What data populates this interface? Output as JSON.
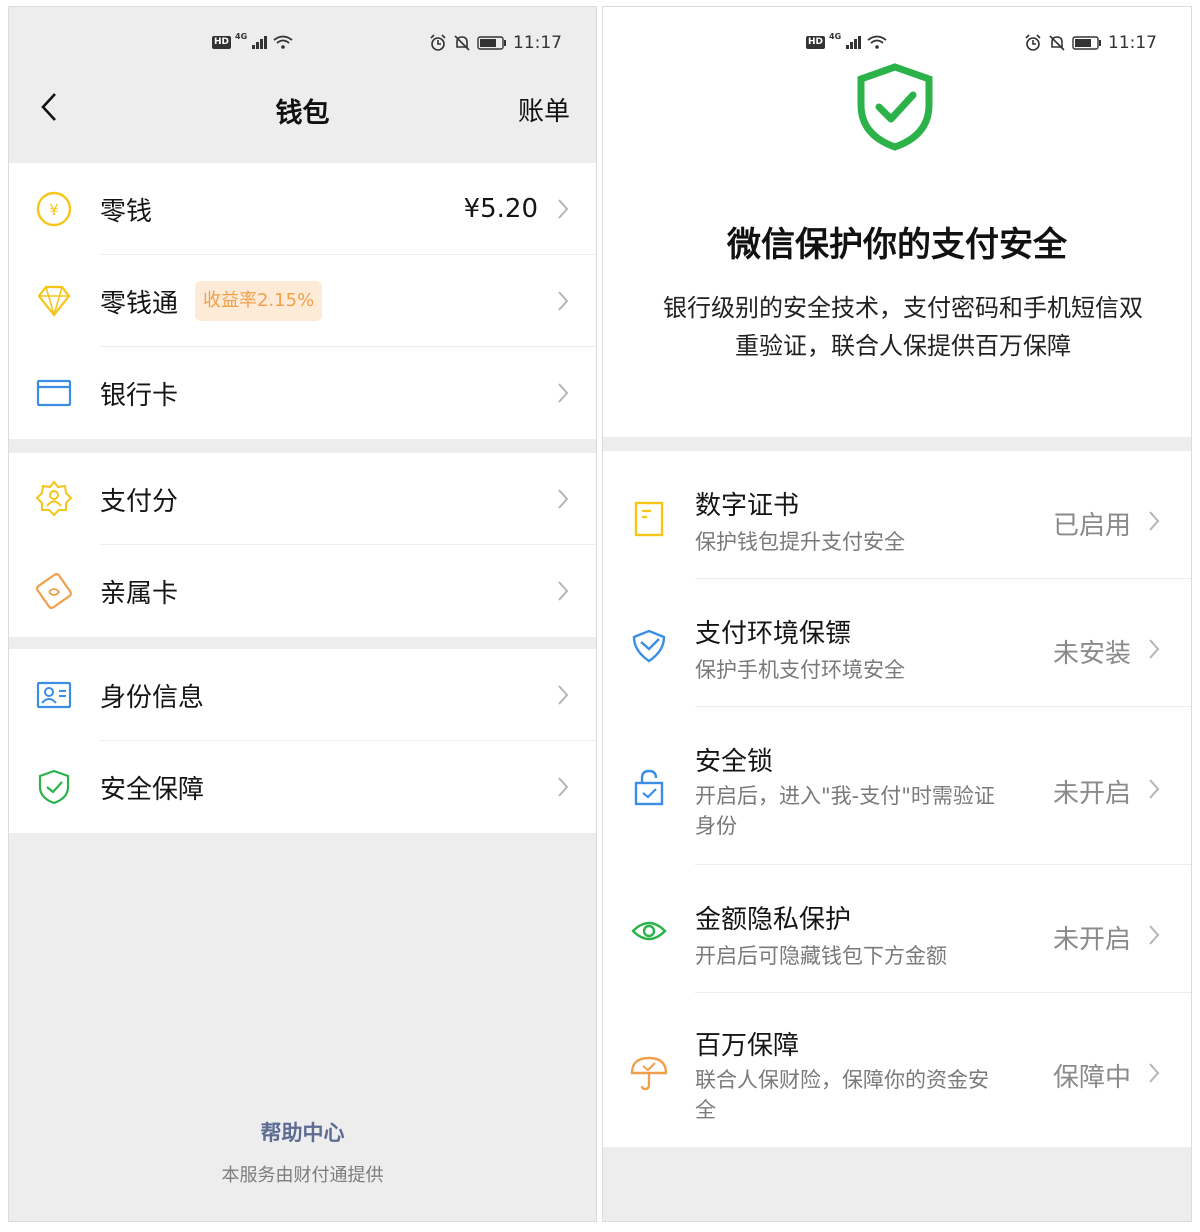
{
  "status_bar": {
    "time": "11:17",
    "hd": "HD",
    "net": "4G"
  },
  "wallet": {
    "title": "钱包",
    "bill_link": "账单",
    "items": [
      {
        "label": "零钱",
        "value": "¥5.20",
        "icon": "yuan-coin-icon",
        "color": "#f5c518"
      },
      {
        "label": "零钱通",
        "tag": "收益率2.15%",
        "icon": "diamond-icon",
        "color": "#f5c518"
      },
      {
        "label": "银行卡",
        "icon": "bank-card-icon",
        "color": "#3a8ee6"
      },
      {
        "label": "支付分",
        "icon": "score-badge-icon",
        "color": "#f5c518"
      },
      {
        "label": "亲属卡",
        "icon": "family-card-icon",
        "color": "#f0a04b"
      },
      {
        "label": "身份信息",
        "icon": "id-card-icon",
        "color": "#3a8ee6"
      },
      {
        "label": "安全保障",
        "icon": "shield-check-icon",
        "color": "#2bb34a"
      }
    ],
    "help_center": "帮助中心",
    "provider_note": "本服务由财付通提供"
  },
  "security": {
    "title": "微信保护你的支付安全",
    "description": "银行级别的安全技术，支付密码和手机短信双重验证，联合人保提供百万保障",
    "accent_color": "#2bb34a",
    "features": [
      {
        "title": "数字证书",
        "subtitle": "保护钱包提升支付安全",
        "status": "已启用",
        "icon": "certificate-icon",
        "color": "#f5c518"
      },
      {
        "title": "支付环境保镖",
        "subtitle": "保护手机支付环境安全",
        "status": "未安装",
        "icon": "guard-shield-icon",
        "color": "#3a8ee6"
      },
      {
        "title": "安全锁",
        "subtitle": "开启后，进入\"我-支付\"时需验证身份",
        "status": "未开启",
        "icon": "lock-icon",
        "color": "#3a8ee6"
      },
      {
        "title": "金额隐私保护",
        "subtitle": "开启后可隐藏钱包下方金额",
        "status": "未开启",
        "icon": "eye-icon",
        "color": "#2bb34a"
      },
      {
        "title": "百万保障",
        "subtitle": "联合人保财险，保障你的资金安全",
        "status": "保障中",
        "icon": "umbrella-icon",
        "color": "#f0a04b"
      }
    ]
  }
}
